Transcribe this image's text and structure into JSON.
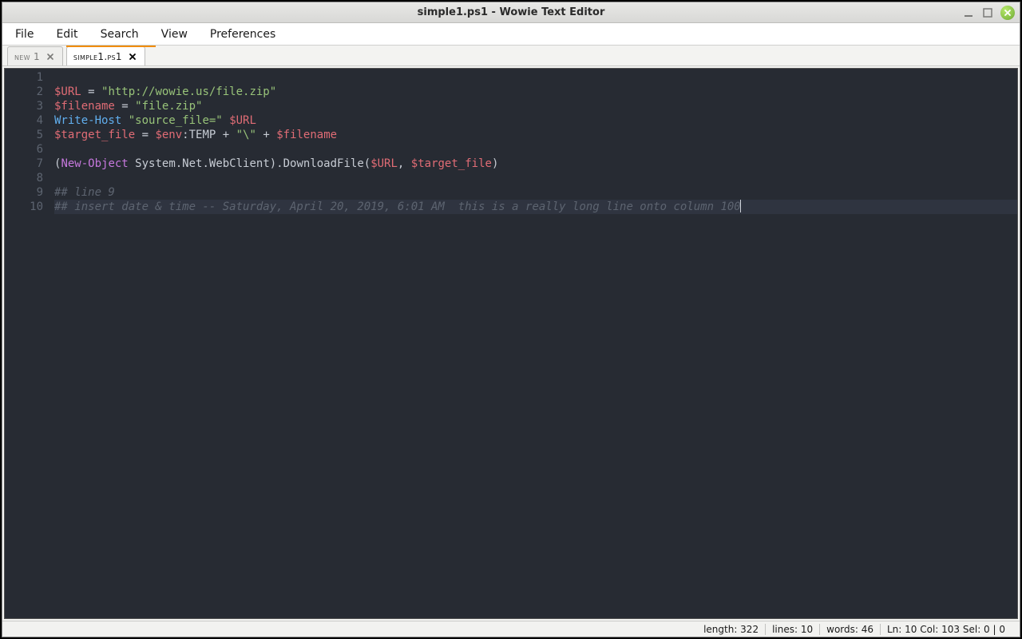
{
  "window": {
    "title": "simple1.ps1 - Wowie Text Editor"
  },
  "menu": {
    "items": [
      "File",
      "Edit",
      "Search",
      "View",
      "Preferences"
    ]
  },
  "tabs": [
    {
      "label": "new 1",
      "active": false
    },
    {
      "label": "simple1.ps1",
      "active": true
    }
  ],
  "editor": {
    "line_count": 10,
    "current_line": 10,
    "lines": [
      {
        "n": 1,
        "tokens": []
      },
      {
        "n": 2,
        "tokens": [
          {
            "c": "tok-var",
            "t": "$URL"
          },
          {
            "c": "tok-op",
            "t": " = "
          },
          {
            "c": "tok-str",
            "t": "\"http://wowie.us/file.zip\""
          }
        ]
      },
      {
        "n": 3,
        "tokens": [
          {
            "c": "tok-var",
            "t": "$filename"
          },
          {
            "c": "tok-op",
            "t": " = "
          },
          {
            "c": "tok-str",
            "t": "\"file.zip\""
          }
        ]
      },
      {
        "n": 4,
        "tokens": [
          {
            "c": "tok-cmd",
            "t": "Write-Host"
          },
          {
            "c": "tok-op",
            "t": " "
          },
          {
            "c": "tok-str",
            "t": "\"source_file=\""
          },
          {
            "c": "tok-op",
            "t": " "
          },
          {
            "c": "tok-var",
            "t": "$URL"
          }
        ]
      },
      {
        "n": 5,
        "tokens": [
          {
            "c": "tok-var",
            "t": "$target_file"
          },
          {
            "c": "tok-op",
            "t": " = "
          },
          {
            "c": "tok-var",
            "t": "$env"
          },
          {
            "c": "tok-op",
            "t": ":"
          },
          {
            "c": "tok-txt",
            "t": "TEMP"
          },
          {
            "c": "tok-op",
            "t": " + "
          },
          {
            "c": "tok-str",
            "t": "\"\\\""
          },
          {
            "c": "tok-op",
            "t": " + "
          },
          {
            "c": "tok-var",
            "t": "$filename"
          }
        ]
      },
      {
        "n": 6,
        "tokens": []
      },
      {
        "n": 7,
        "tokens": [
          {
            "c": "tok-op",
            "t": "("
          },
          {
            "c": "tok-key",
            "t": "New-Object"
          },
          {
            "c": "tok-op",
            "t": " "
          },
          {
            "c": "tok-txt",
            "t": "System.Net.WebClient"
          },
          {
            "c": "tok-op",
            "t": ")."
          },
          {
            "c": "tok-txt",
            "t": "DownloadFile"
          },
          {
            "c": "tok-op",
            "t": "("
          },
          {
            "c": "tok-var",
            "t": "$URL"
          },
          {
            "c": "tok-op",
            "t": ", "
          },
          {
            "c": "tok-var",
            "t": "$target_file"
          },
          {
            "c": "tok-op",
            "t": ")"
          }
        ]
      },
      {
        "n": 8,
        "tokens": []
      },
      {
        "n": 9,
        "tokens": [
          {
            "c": "tok-comm",
            "t": "## line 9"
          }
        ]
      },
      {
        "n": 10,
        "tokens": [
          {
            "c": "tok-comm",
            "t": "## insert date & time -- Saturday, April 20, 2019, 6:01 AM  this is a really long line onto column 100"
          }
        ],
        "caret": true
      }
    ]
  },
  "status": {
    "length_label": "length: 322",
    "lines_label": "lines: 10",
    "words_label": "words: 46",
    "pos_label": "Ln: 10  Col: 103  Sel: 0 | 0"
  }
}
